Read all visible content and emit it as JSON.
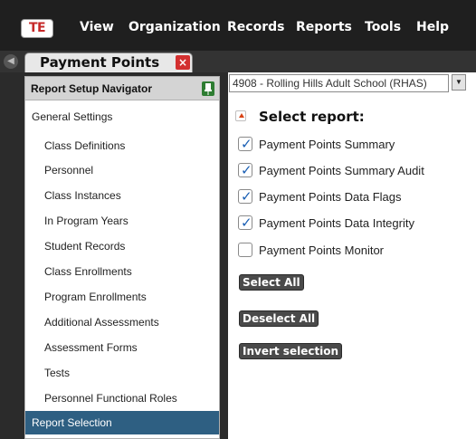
{
  "app": {
    "logo_text": "TE"
  },
  "menu": [
    "View",
    "Organization",
    "Records",
    "Reports",
    "Tools",
    "Help"
  ],
  "tab": {
    "label": "Payment Points",
    "close_glyph": "×"
  },
  "navigator": {
    "title": "Report Setup Navigator",
    "pin_icon": "pin-icon",
    "items": [
      {
        "label": "General Settings",
        "indent": 0,
        "selected": false
      },
      {
        "label": "Class Definitions",
        "indent": 1,
        "selected": false
      },
      {
        "label": "Personnel",
        "indent": 1,
        "selected": false
      },
      {
        "label": "Class Instances",
        "indent": 1,
        "selected": false
      },
      {
        "label": "In Program Years",
        "indent": 1,
        "selected": false
      },
      {
        "label": "Student Records",
        "indent": 1,
        "selected": false
      },
      {
        "label": "Class Enrollments",
        "indent": 1,
        "selected": false
      },
      {
        "label": "Program Enrollments",
        "indent": 1,
        "selected": false
      },
      {
        "label": "Additional Assessments",
        "indent": 1,
        "selected": false
      },
      {
        "label": "Assessment Forms",
        "indent": 1,
        "selected": false
      },
      {
        "label": "Tests",
        "indent": 1,
        "selected": false
      },
      {
        "label": "Personnel Functional Roles",
        "indent": 1,
        "selected": false
      },
      {
        "label": "Report Selection",
        "indent": 0,
        "selected": true
      }
    ]
  },
  "school_select": {
    "value": "4908 - Rolling Hills Adult School (RHAS)"
  },
  "report_section": {
    "title": "Select report:",
    "reports": [
      {
        "label": "Payment Points Summary",
        "checked": true
      },
      {
        "label": "Payment Points Summary Audit",
        "checked": true
      },
      {
        "label": "Payment Points Data Flags",
        "checked": true
      },
      {
        "label": "Payment Points Data Integrity",
        "checked": true
      },
      {
        "label": "Payment Points Monitor",
        "checked": false
      }
    ],
    "buttons": {
      "select_all": "Select All",
      "deselect_all": "Deselect All",
      "invert": "Invert selection"
    }
  },
  "colors": {
    "menubar_bg": "#1f1f1f",
    "selected_nav_bg": "#2e5f82",
    "close_red": "#d32f2f",
    "checkmark_blue": "#1a5fb4"
  }
}
